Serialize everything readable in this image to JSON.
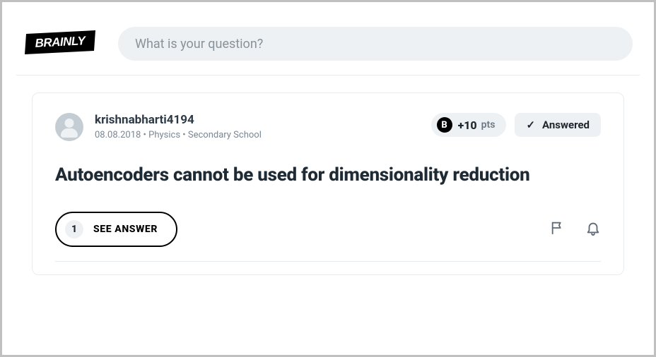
{
  "header": {
    "logo_text": "BRAINLY",
    "search_placeholder": "What is your question?"
  },
  "question": {
    "author": "krishnabharti4194",
    "meta": "08.08.2018  •  Physics  •  Secondary School",
    "points": "+10",
    "points_unit": "pts",
    "answered_label": "Answered",
    "title": "Autoencoders cannot be used for dimensionality reduction",
    "answer_count": "1",
    "see_answer_label": "SEE ANSWER"
  }
}
